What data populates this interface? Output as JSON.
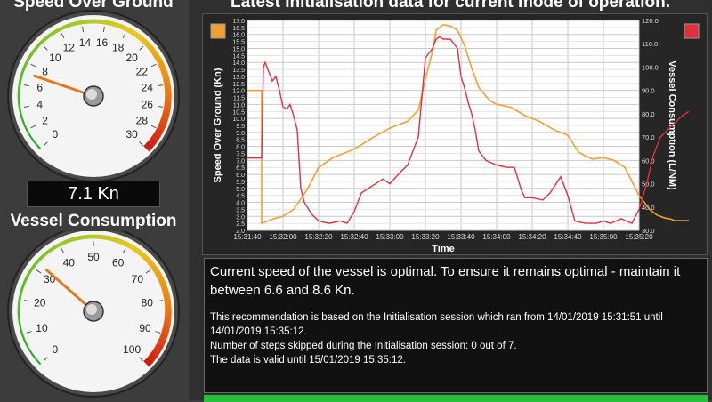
{
  "gauges": {
    "speed": {
      "title": "Speed Over Ground",
      "readout": "7.1 Kn",
      "ticks": [
        "0",
        "2",
        "4",
        "6",
        "8",
        "10",
        "12",
        "14",
        "16",
        "18",
        "20",
        "22",
        "24",
        "26",
        "28",
        "30"
      ],
      "min": 0,
      "max": 30,
      "value": 7.1
    },
    "consumption": {
      "title": "Vessel Consumption",
      "ticks": [
        "0",
        "10",
        "20",
        "30",
        "40",
        "50",
        "60",
        "70",
        "80",
        "90",
        "100"
      ],
      "min": 0,
      "max": 100,
      "value": 32
    }
  },
  "chart": {
    "title": "Latest Initialisation data for current mode of operation.",
    "left_axis_label": "Speed Over Ground (Kn)",
    "right_axis_label": "Vessel Consumption (L/NM)",
    "x_axis_label": "Time",
    "legend_left_color": "#f0a030",
    "legend_right_color": "#e03040"
  },
  "chart_data": {
    "type": "line",
    "xlabel": "Time",
    "ylabel": "Speed Over Ground (Kn)",
    "y2label": "Vessel Consumption (L/NM)",
    "ylim": [
      2.0,
      17.0
    ],
    "y2lim": [
      30.0,
      120.0
    ],
    "x_tick_labels": [
      "15:31:40",
      "15:32:00",
      "15:32:20",
      "15:32:40",
      "15:33:00",
      "15:33:20",
      "15:33:40",
      "15:34:00",
      "15:34:20",
      "15:34:40",
      "15:35:00",
      "15:35:20"
    ],
    "y_tick_labels": [
      "2.0",
      "2.5",
      "3.0",
      "3.5",
      "4.0",
      "4.5",
      "5.0",
      "5.5",
      "6.0",
      "6.5",
      "7.0",
      "7.5",
      "8.0",
      "8.5",
      "9.0",
      "9.5",
      "10.0",
      "10.5",
      "11.0",
      "11.5",
      "12.0",
      "12.5",
      "13.0",
      "13.5",
      "14.0",
      "14.5",
      "15.0",
      "15.5",
      "16.0",
      "16.5",
      "17.0"
    ],
    "y2_tick_labels": [
      "30.0",
      "40.0",
      "50.0",
      "60.0",
      "70.0",
      "80.0",
      "90.0",
      "100.0",
      "110.0",
      "120.0"
    ],
    "series": [
      {
        "axis": "left",
        "color": "#f0a030",
        "x_seconds": [
          0,
          6,
          8,
          8,
          10,
          14,
          20,
          26,
          34,
          40,
          48,
          60,
          70,
          80,
          90,
          96,
          100,
          104,
          106,
          110,
          114,
          118,
          122,
          126,
          130,
          134,
          136,
          140,
          148,
          156,
          164,
          172,
          180,
          186,
          190,
          194,
          200,
          206,
          212,
          220,
          226,
          230,
          234,
          238,
          240,
          244,
          248
        ],
        "values": [
          12.0,
          12.0,
          12.0,
          2.5,
          2.6,
          2.8,
          3.0,
          3.5,
          5.0,
          6.5,
          7.2,
          7.8,
          8.6,
          9.3,
          9.8,
          10.6,
          12.8,
          14.8,
          16.3,
          16.7,
          16.6,
          16.3,
          15.2,
          13.6,
          12.2,
          11.6,
          11.3,
          11.0,
          10.8,
          10.2,
          9.8,
          9.2,
          8.8,
          7.6,
          7.3,
          7.1,
          7.2,
          7.0,
          6.5,
          4.5,
          3.5,
          3.1,
          2.9,
          2.8,
          2.7,
          2.7,
          2.7
        ]
      },
      {
        "axis": "right",
        "color": "#e03040",
        "x_seconds": [
          0,
          6,
          8,
          9,
          10,
          12,
          14,
          16,
          18,
          20,
          22,
          24,
          26,
          28,
          30,
          32,
          36,
          40,
          46,
          52,
          56,
          60,
          64,
          70,
          76,
          80,
          86,
          90,
          96,
          100,
          104,
          106,
          108,
          110,
          114,
          118,
          120,
          122,
          124,
          126,
          128,
          130,
          134,
          140,
          146,
          150,
          154,
          156,
          160,
          166,
          170,
          176,
          180,
          184,
          190,
          196,
          200,
          204,
          210,
          216,
          220,
          224,
          228,
          232,
          236,
          240,
          244,
          248
        ],
        "values": [
          61,
          61,
          61,
          100,
          102,
          98,
          94,
          96,
          90,
          83,
          82,
          84,
          79,
          73,
          48,
          42,
          37,
          34,
          33,
          34,
          33,
          38,
          46,
          49,
          52,
          50,
          55,
          58,
          70,
          104,
          108,
          112,
          113,
          112,
          112,
          108,
          96,
          91,
          85,
          80,
          73,
          64,
          60,
          58,
          57,
          57,
          47,
          44,
          44,
          43,
          46,
          53,
          45,
          34,
          33,
          33,
          34,
          33,
          35,
          33,
          39,
          49,
          62,
          70,
          73,
          76,
          79,
          81
        ]
      }
    ]
  },
  "message": {
    "main": "Current speed of the vessel is optimal. To ensure it remains optimal - maintain it between 6.6 and 8.6 Kn.",
    "line1": "This recommendation is based on the Initialisation session which ran from 14/01/2019 15:31:51 until 14/01/2019 15:35:12.",
    "line2": "Number of steps skipped during the Initialisation session: 0 out of 7.",
    "line3": "The data is valid until 15/01/2019 15:35:12."
  }
}
